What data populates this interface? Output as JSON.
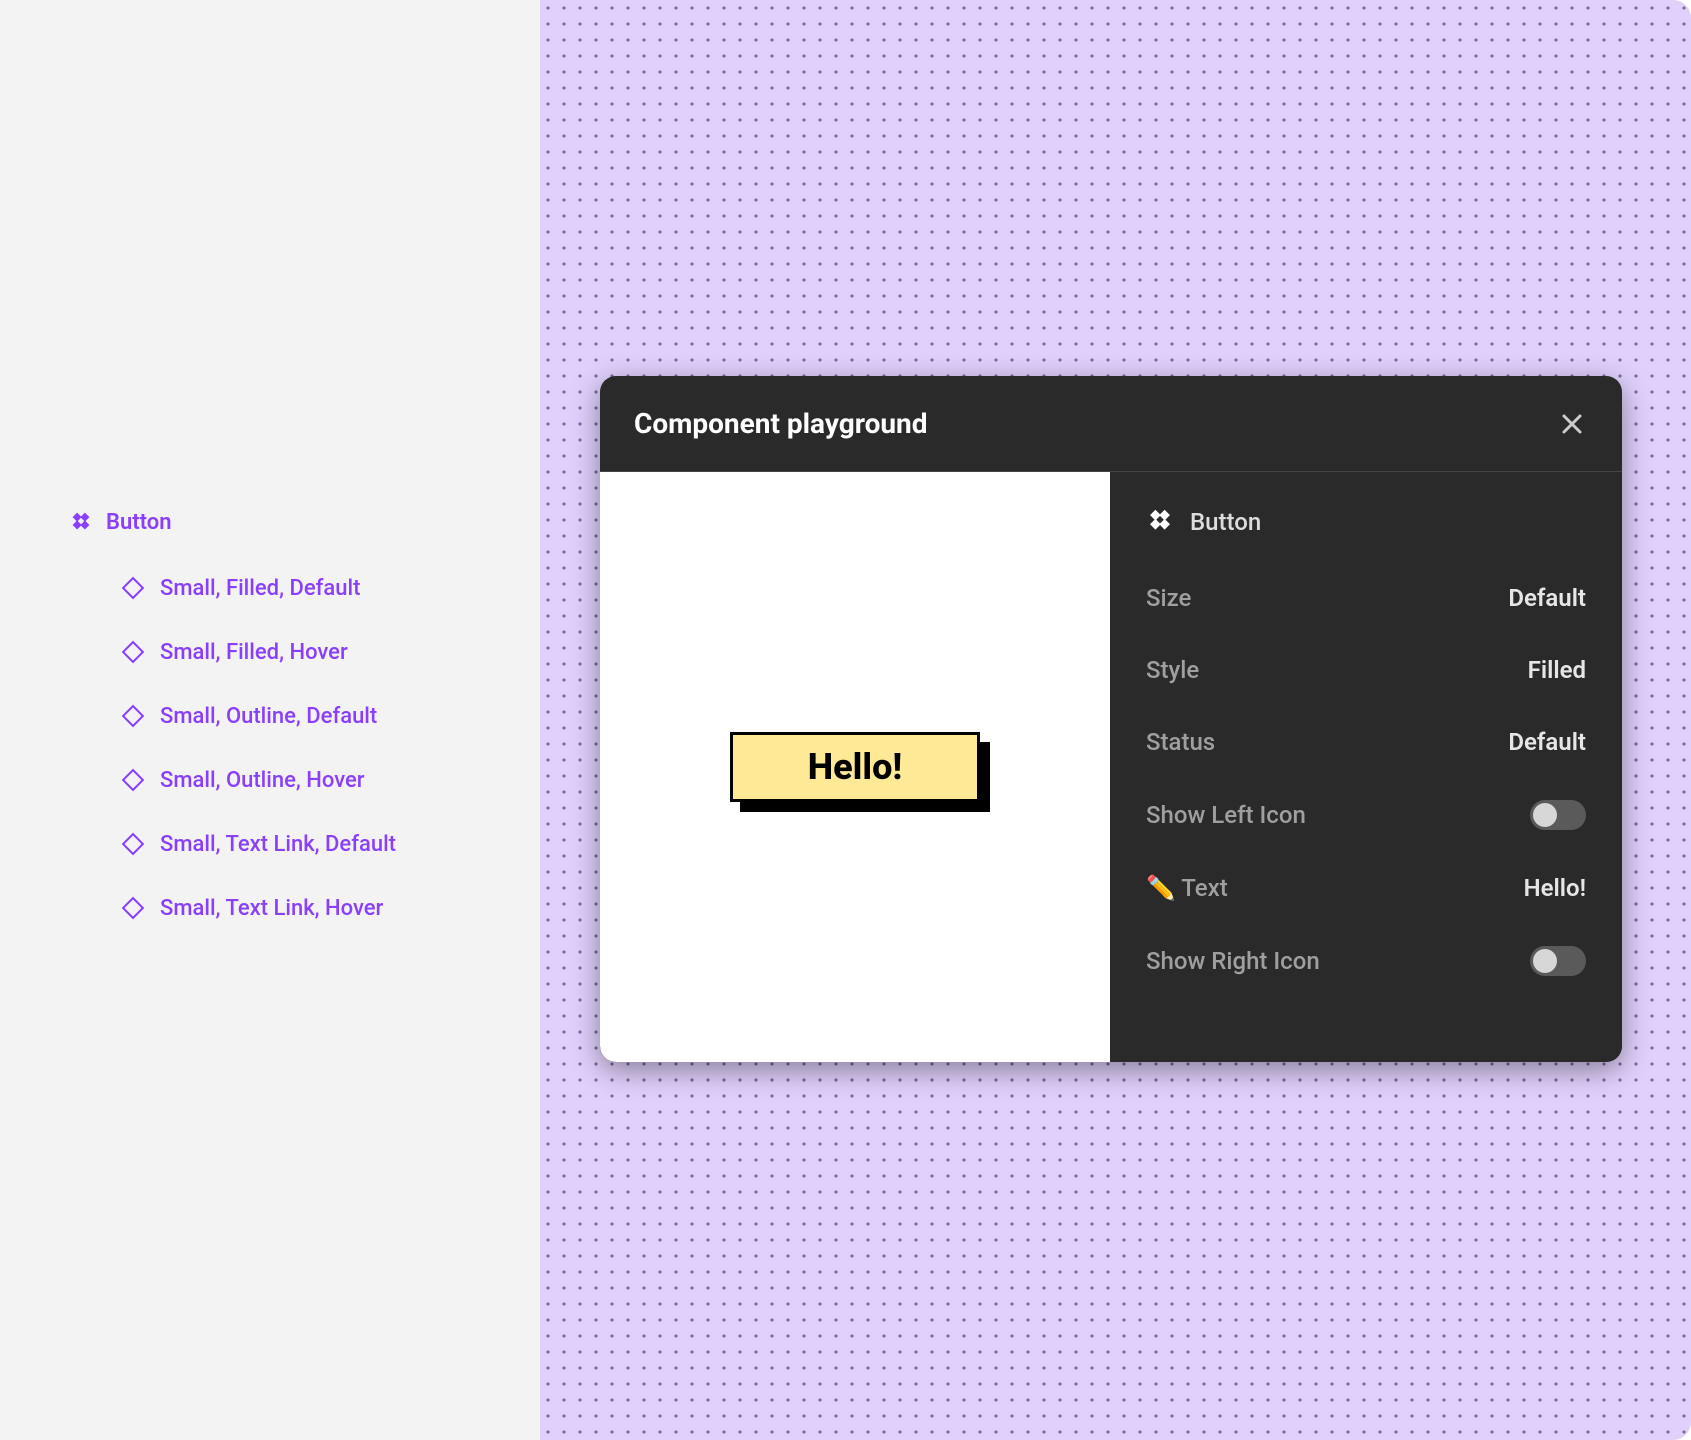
{
  "sidebar": {
    "parent_label": "Button",
    "variants": [
      "Small, Filled, Default",
      "Small, Filled, Hover",
      "Small, Outline, Default",
      "Small, Outline, Hover",
      "Small, Text Link, Default",
      "Small, Text Link, Hover"
    ]
  },
  "playground": {
    "title": "Component playground",
    "component_label": "Button",
    "preview_text": "Hello!",
    "props": {
      "size": {
        "label": "Size",
        "value": "Default"
      },
      "style": {
        "label": "Style",
        "value": "Filled"
      },
      "status": {
        "label": "Status",
        "value": "Default"
      },
      "show_left_icon": {
        "label": "Show Left Icon",
        "on": false
      },
      "text": {
        "label": "✏️ Text",
        "value": "Hello!"
      },
      "show_right_icon": {
        "label": "Show Right Icon",
        "on": false
      }
    }
  }
}
